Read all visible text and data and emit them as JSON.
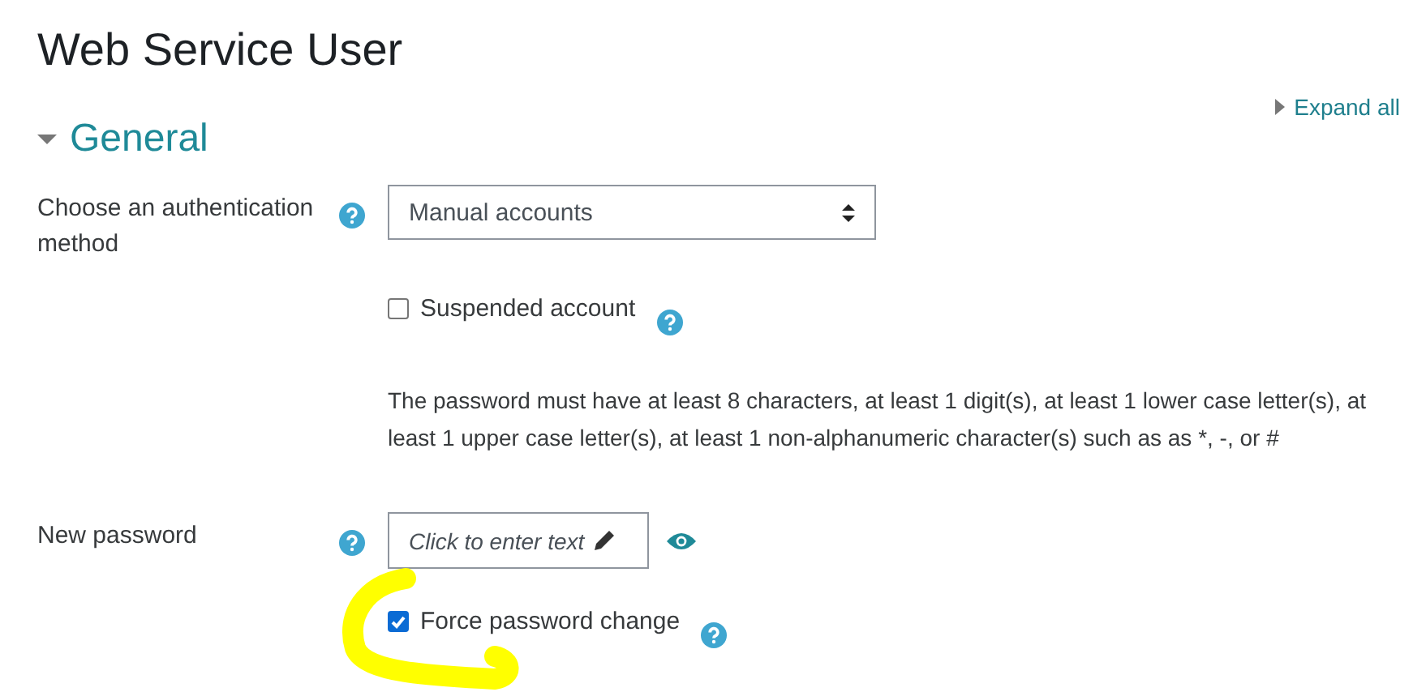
{
  "page_title": "Web Service User",
  "expand_all": "Expand all",
  "section": {
    "title": "General",
    "expanded": true
  },
  "fields": [
    {
      "kind": "select",
      "label": "Choose an authentication method",
      "value": "Manual accounts"
    },
    {
      "kind": "checkbox",
      "label": "Suspended account",
      "checked": false
    },
    {
      "kind": "note",
      "text": "The password must have at least 8 characters, at least 1 digit(s), at least 1 lower case letter(s), at least 1 upper case letter(s), at least 1 non-alphanumeric character(s) such as as *, -, or #"
    },
    {
      "kind": "password",
      "label": "New password",
      "placeholder": "Click to enter text"
    },
    {
      "kind": "checkbox",
      "label": "Force password change",
      "checked": true
    }
  ]
}
